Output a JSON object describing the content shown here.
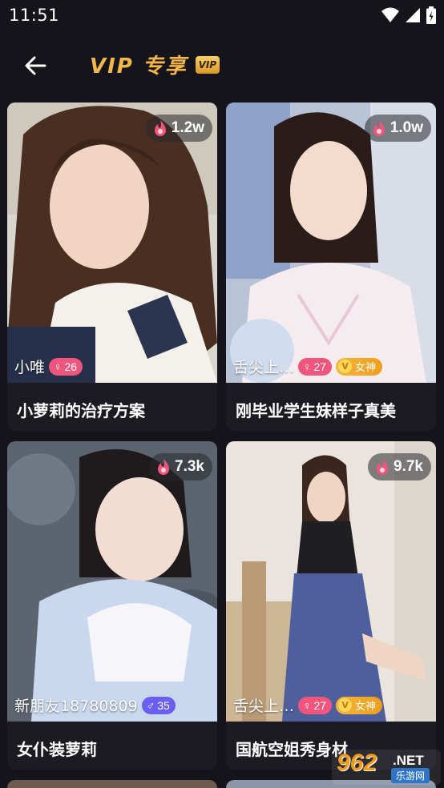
{
  "status_bar": {
    "time": "11:51"
  },
  "header": {
    "title": "VIP 专享",
    "badge": "VIP"
  },
  "cards": [
    {
      "views": "1.2w",
      "author": "小唯",
      "age": "26",
      "gender": "female",
      "goddess": "",
      "title": "小萝莉的治疗方案"
    },
    {
      "views": "1.0w",
      "author": "舌尖上…",
      "age": "27",
      "gender": "female",
      "goddess": "女神",
      "title": "刚毕业学生妹样子真美"
    },
    {
      "views": "7.3k",
      "author": "新朋友18780809",
      "age": "35",
      "gender": "male",
      "goddess": "",
      "title": "女仆装萝莉"
    },
    {
      "views": "9.7k",
      "author": "舌尖上…",
      "age": "27",
      "gender": "female",
      "goddess": "女神",
      "title": "国航空姐秀身材"
    }
  ],
  "watermark": {
    "main": "962",
    "net": ".NET",
    "sub": "乐游网"
  }
}
